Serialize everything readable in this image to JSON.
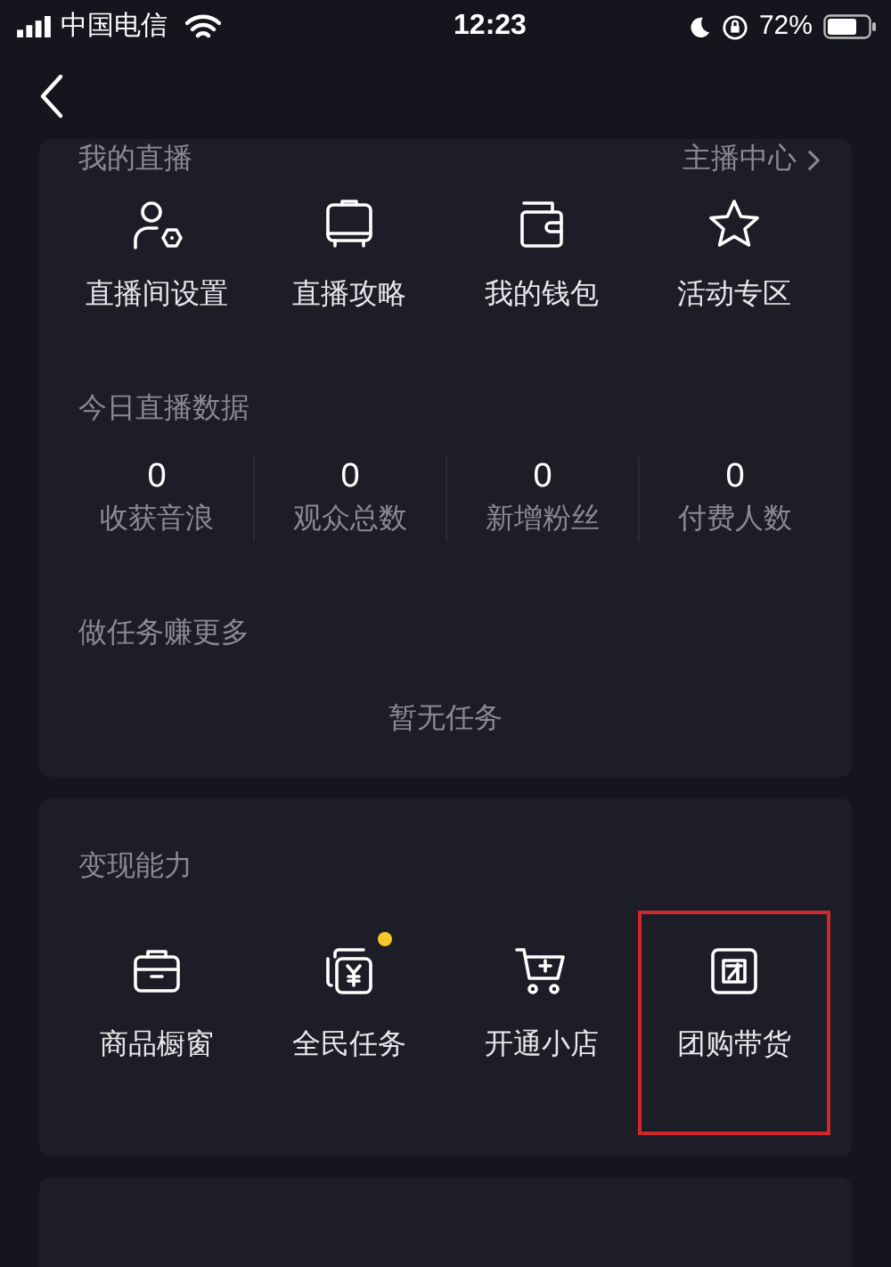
{
  "status_bar": {
    "carrier": "中国电信",
    "time": "12:23",
    "battery": "72%"
  },
  "live_card": {
    "title": "我的直播",
    "link": "主播中心",
    "actions": [
      {
        "kind": "user-gear",
        "label": "直播间设置"
      },
      {
        "kind": "tv",
        "label": "直播攻略"
      },
      {
        "kind": "wallet",
        "label": "我的钱包"
      },
      {
        "kind": "star",
        "label": "活动专区"
      }
    ],
    "stats_title": "今日直播数据",
    "stats": [
      {
        "value": "0",
        "label": "收获音浪"
      },
      {
        "value": "0",
        "label": "观众总数"
      },
      {
        "value": "0",
        "label": "新增粉丝"
      },
      {
        "value": "0",
        "label": "付费人数"
      }
    ],
    "tasks_title": "做任务赚更多",
    "tasks_empty": "暂无任务"
  },
  "monetize_card": {
    "title": "变现能力",
    "items": [
      {
        "kind": "briefcase",
        "label": "商品橱窗",
        "dot": false,
        "highlighted": false
      },
      {
        "kind": "yen",
        "label": "全民任务",
        "dot": true,
        "highlighted": false
      },
      {
        "kind": "cart",
        "label": "开通小店",
        "dot": false,
        "highlighted": false
      },
      {
        "kind": "group",
        "label": "团购带货",
        "dot": false,
        "highlighted": true
      }
    ]
  }
}
